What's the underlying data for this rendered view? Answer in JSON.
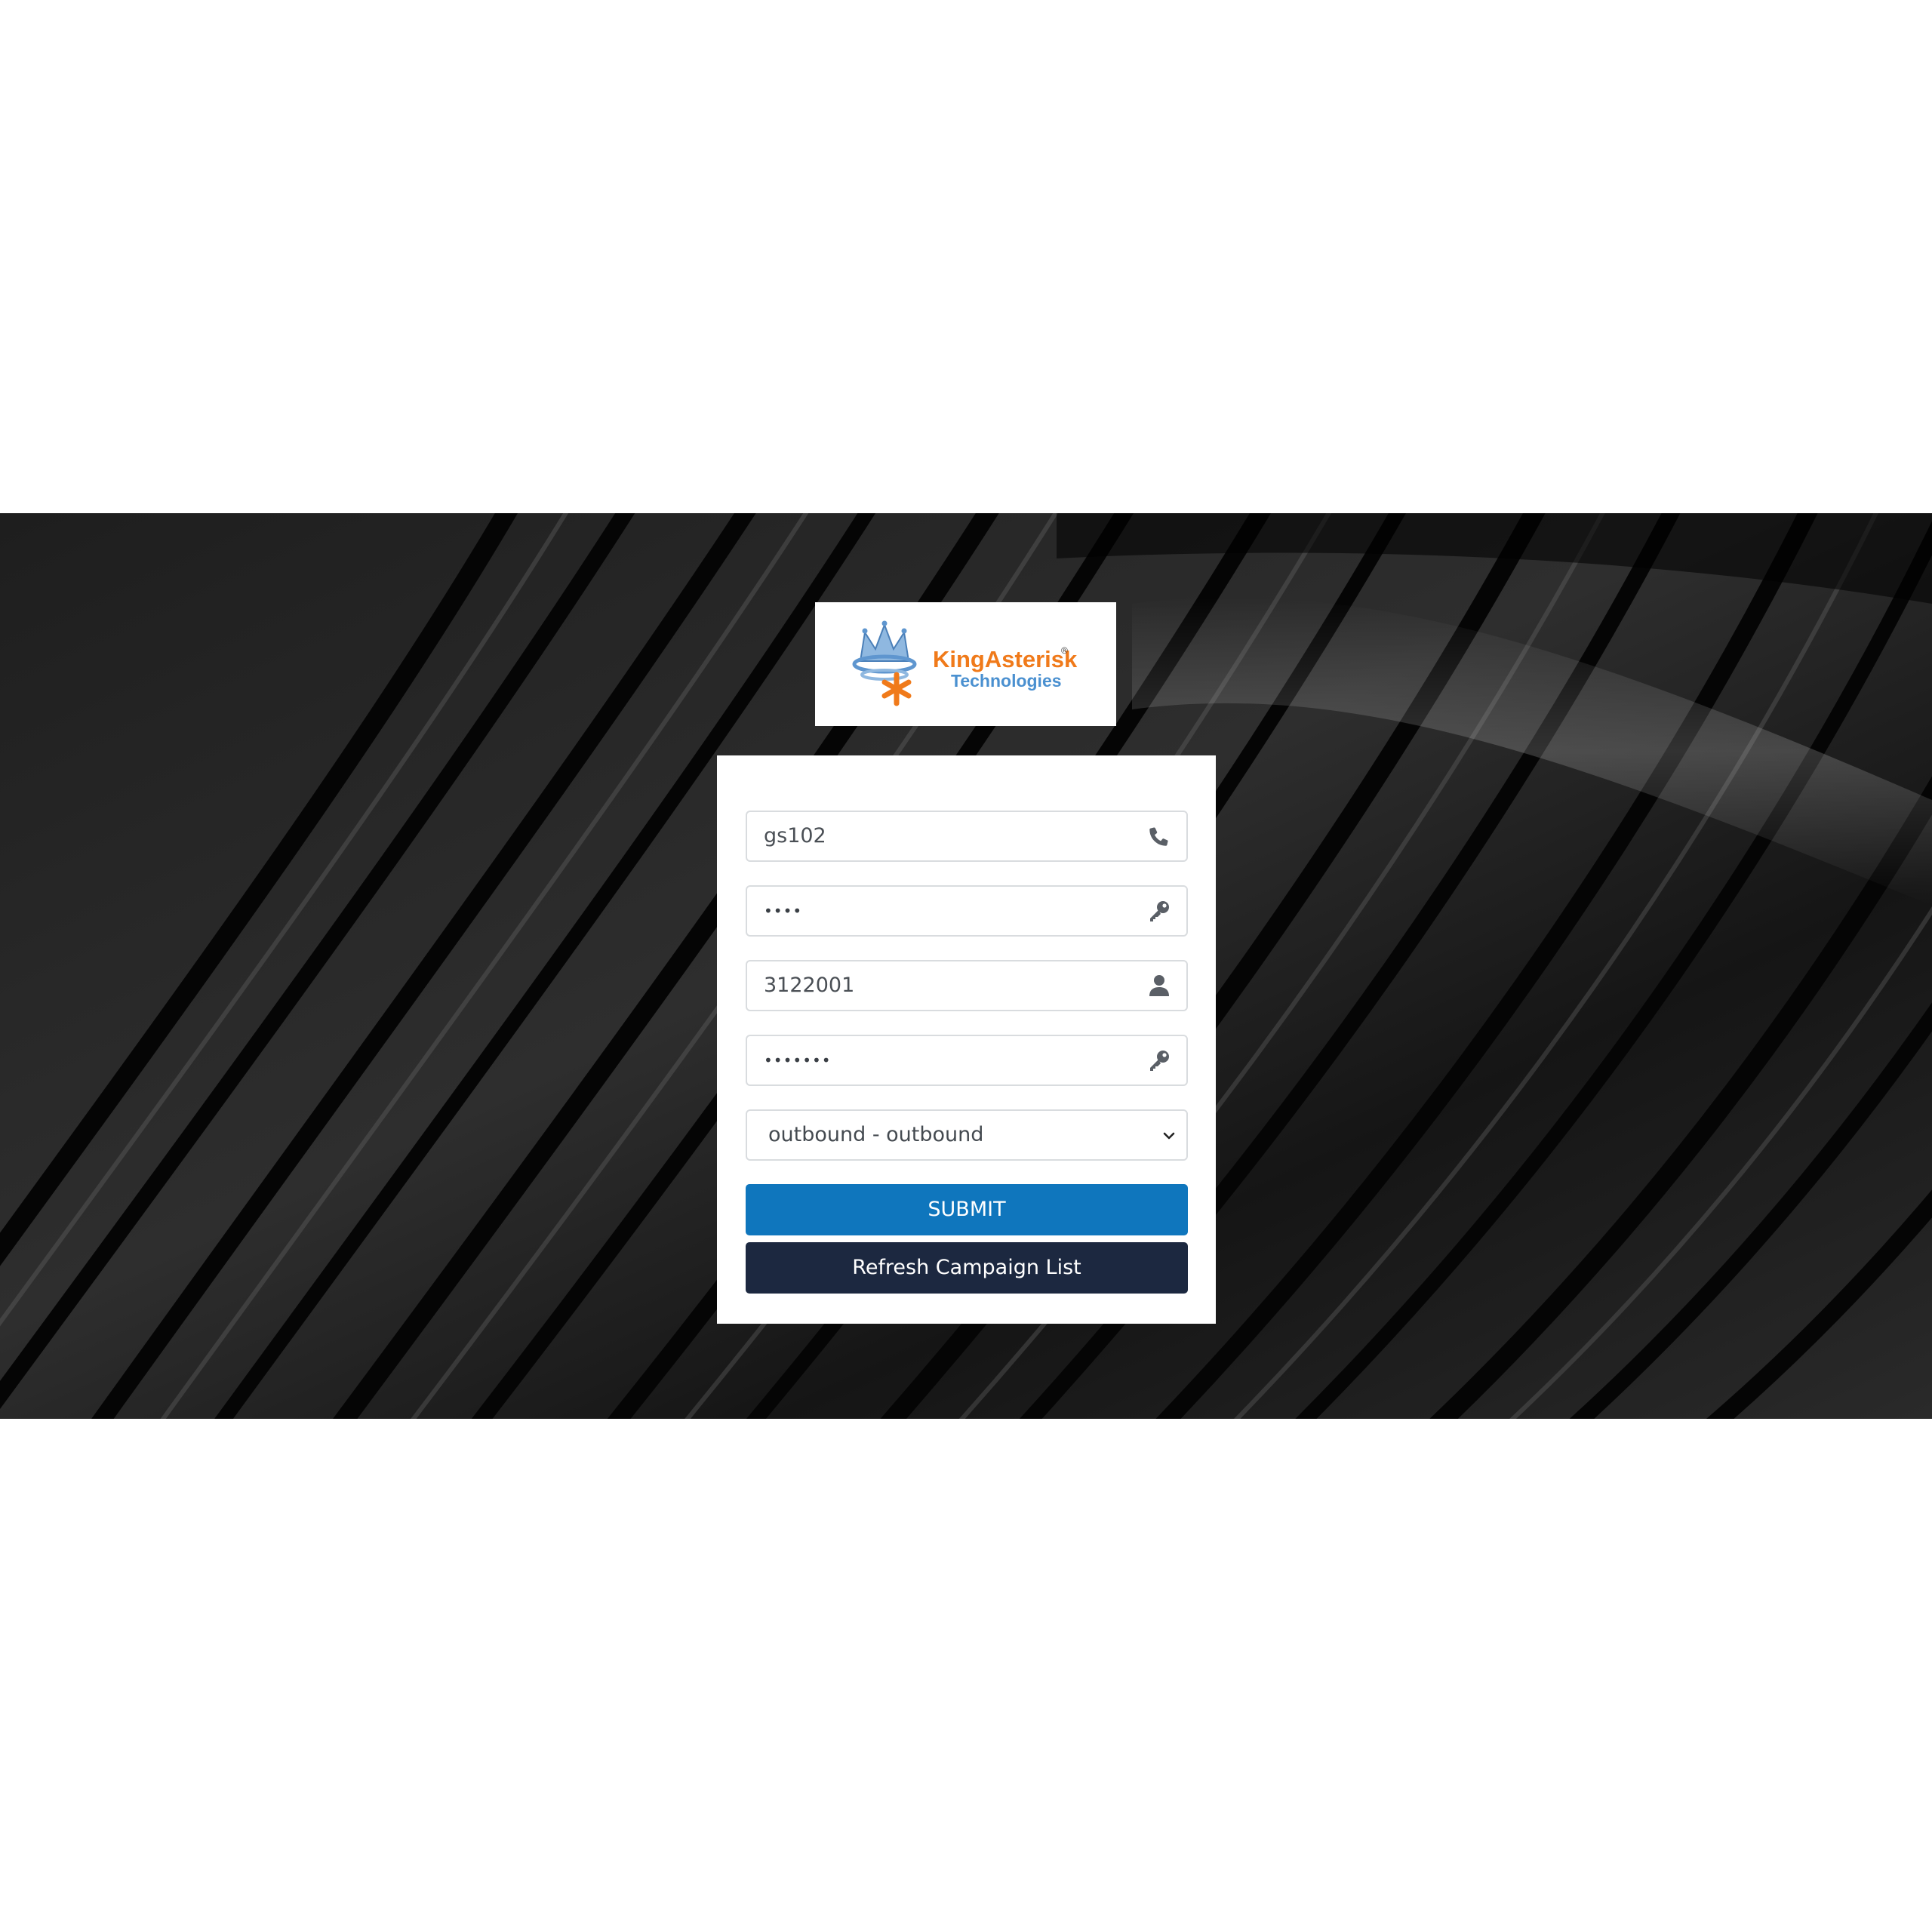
{
  "logo": {
    "brand_name": "KingAsterisk",
    "brand_sub": "Technologies",
    "registered_mark": "®"
  },
  "form": {
    "phone_login": {
      "value": "gs102",
      "icon": "phone-icon"
    },
    "phone_password": {
      "value": "••••",
      "icon": "key-icon"
    },
    "user_login": {
      "value": "3122001",
      "icon": "user-icon"
    },
    "user_password": {
      "value": "•••••••",
      "icon": "key-icon"
    },
    "campaign_select": {
      "selected": "outbound - outbound"
    },
    "submit_label": "SUBMIT",
    "refresh_label": "Refresh Campaign List"
  },
  "colors": {
    "submit_button": "#0f76bd",
    "refresh_button": "#1c2840",
    "brand_orange": "#f07a1a",
    "brand_blue": "#4a90d0"
  }
}
